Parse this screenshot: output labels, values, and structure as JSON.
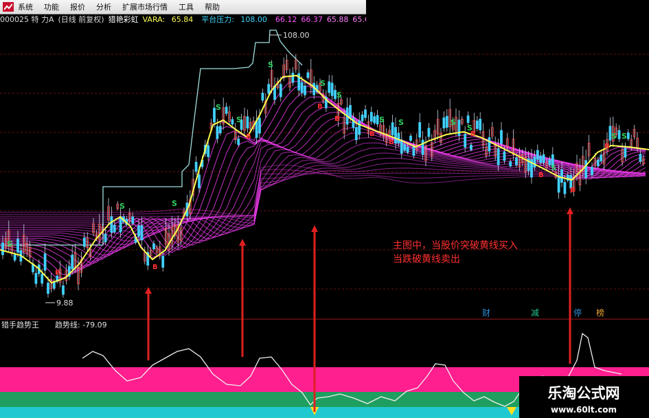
{
  "menu": [
    "系统",
    "功能",
    "报价",
    "分析",
    "扩展市场行情",
    "工具",
    "帮助"
  ],
  "info": {
    "stock": "000025 特 力A",
    "period": "(日线 前复权)",
    "indicator": "猎艳彩虹",
    "vara_label": "VARA:",
    "vara_value": "65.84",
    "platform_label": "平台压力:",
    "platform_value": "108.00",
    "values": [
      "66.12",
      "66.37",
      "65.88",
      "65.6"
    ]
  },
  "chart": {
    "high_label": "108.00",
    "low_label": "9.88",
    "annotation_line1": "主图中，当股价突破黄线买入",
    "annotation_line2": "当跌破黄线卖出",
    "sub_title": "猎手趋势王",
    "sub_metric": "趋势线: -79.09",
    "badges": [
      {
        "text": "财",
        "color": "#2a8fd8"
      },
      {
        "text": "减",
        "color": "#22c48a"
      },
      {
        "text": "停",
        "color": "#2a8fd8"
      },
      {
        "text": "榜",
        "color": "#e8a030"
      }
    ],
    "buy_marker": "B",
    "sell_marker": "S"
  },
  "colors": {
    "price_bar_up": "#ff4040",
    "price_bar_down": "#40d0ff",
    "yellow_line": "#ffff50",
    "ribbon": "#ff40ff",
    "band_pink": "#ff1f8f",
    "band_green": "#1f9f5f",
    "band_cyan": "#20c8d0",
    "arrow_red": "#e02020"
  },
  "watermark": {
    "title": "乐淘公式网",
    "url": "www.60lt.com"
  }
}
